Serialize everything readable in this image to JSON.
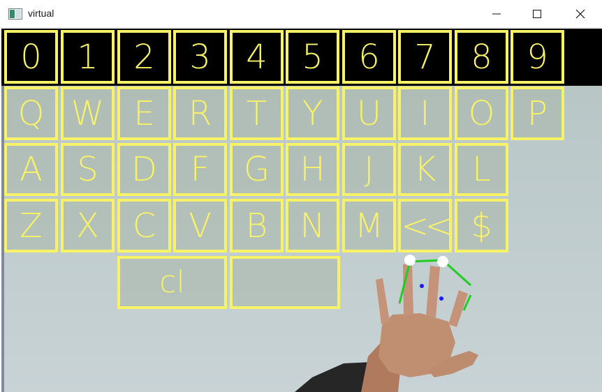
{
  "window": {
    "title": "virtual",
    "controls": {
      "minimize": "minimize",
      "maximize": "maximize",
      "close": "close"
    }
  },
  "keyboard": {
    "row_numbers": [
      "0",
      "1",
      "2",
      "3",
      "4",
      "5",
      "6",
      "7",
      "8",
      "9"
    ],
    "row_top": [
      "Q",
      "W",
      "E",
      "R",
      "T",
      "Y",
      "U",
      "I",
      "O",
      "P"
    ],
    "row_home": [
      "A",
      "S",
      "D",
      "F",
      "G",
      "H",
      "J",
      "K",
      "L"
    ],
    "row_bottom": [
      "Z",
      "X",
      "C",
      "V",
      "B",
      "N",
      "M",
      "<<",
      "$"
    ],
    "row_space": [
      "cl",
      ""
    ]
  },
  "colors": {
    "key_outline": "#f8f266",
    "key_text": "#f8f266",
    "landmark_point": "#ffffff",
    "landmark_line": "#22cc22",
    "landmark_center": "#1a1aff"
  }
}
